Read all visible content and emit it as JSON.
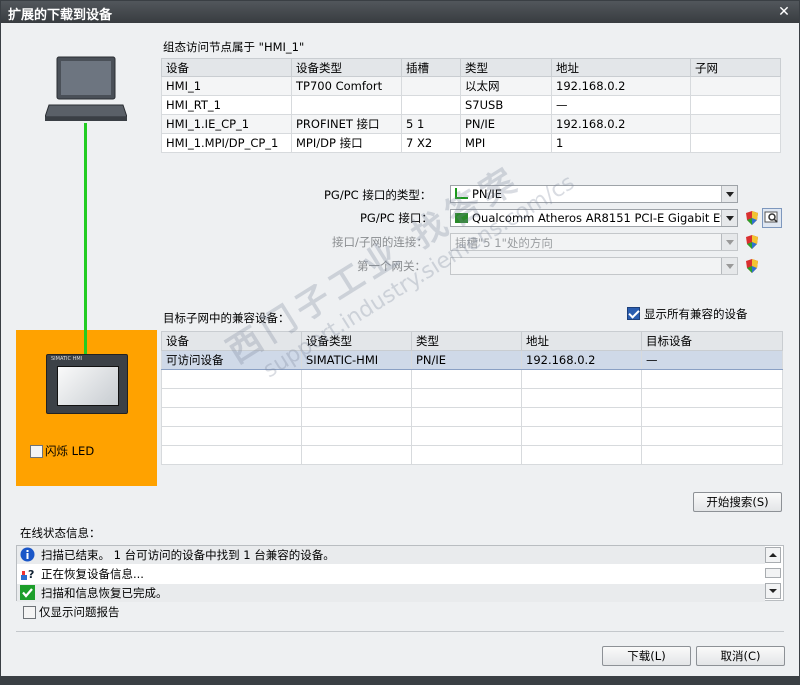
{
  "window": {
    "title": "扩展的下载到设备",
    "close_icon": "close-icon"
  },
  "config_nodes": {
    "heading": "组态访问节点属于 \"HMI_1\"",
    "columns": [
      "设备",
      "设备类型",
      "插槽",
      "类型",
      "地址",
      "子网"
    ],
    "rows": [
      [
        "HMI_1",
        "TP700 Comfort",
        "",
        "以太网",
        "192.168.0.2",
        ""
      ],
      [
        "HMI_RT_1",
        "",
        "",
        "S7USB",
        "—",
        ""
      ],
      [
        "HMI_1.IE_CP_1",
        "PROFINET 接口",
        "5 1",
        "PN/IE",
        "192.168.0.2",
        ""
      ],
      [
        "HMI_1.MPI/DP_CP_1",
        "MPI/DP 接口",
        "7 X2",
        "MPI",
        "1",
        ""
      ]
    ]
  },
  "pgpc": {
    "type_label": "PG/PC 接口的类型：",
    "type_value": "PN/IE",
    "iface_label": "PG/PC 接口：",
    "iface_value": "Qualcomm Atheros AR8151 PCI-E Gigabit Eth...",
    "conn_label": "接口/子网的连接：",
    "conn_value": "插槽\"5 1\"处的方向",
    "gateway_label": "第一个网关：",
    "gateway_value": ""
  },
  "target": {
    "heading": "目标子网中的兼容设备：",
    "show_all_label": "显示所有兼容的设备",
    "show_all_checked": true,
    "columns": [
      "设备",
      "设备类型",
      "类型",
      "地址",
      "目标设备"
    ],
    "rows": [
      [
        "可访问设备",
        "SIMATIC-HMI",
        "PN/IE",
        "192.168.0.2",
        "—"
      ]
    ],
    "empty_rows": 5
  },
  "flash_led_label": "闪烁 LED",
  "device_screen_label": "SIMATIC HMI",
  "search_button": "开始搜索(S)",
  "status": {
    "heading": "在线状态信息：",
    "messages": [
      {
        "icon": "info-icon",
        "text": "扫描已结束。 1 台可访问的设备中找到 1 台兼容的设备。"
      },
      {
        "icon": "question-icon",
        "text": "正在恢复设备信息..."
      },
      {
        "icon": "check-icon",
        "text": "扫描和信息恢复已完成。"
      }
    ],
    "only_problems_label": "仅显示问题报告"
  },
  "buttons": {
    "download": "下载(L)",
    "cancel": "取消(C)"
  },
  "watermark": {
    "line1": "西门子工业 找答案",
    "line2": "support.industry.siemens.com/cs"
  },
  "colors": {
    "accent_orange": "#ffa200",
    "link_green": "#22cc22",
    "selection": "#cfd9e8"
  }
}
